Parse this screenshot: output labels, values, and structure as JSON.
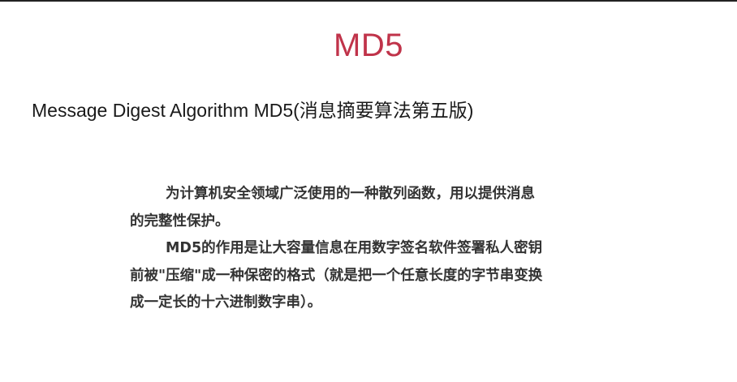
{
  "slide": {
    "title": "MD5",
    "subtitle": "Message Digest Algorithm MD5(消息摘要算法第五版)",
    "body_lines": [
      "为计算机安全领域广泛使用的一种散列函数，用以提供消息",
      "的完整性保护。",
      "MD5的作用是让大容量信息在用数字签名软件签署私人密钥",
      "前被\"压缩\"成一种保密的格式（就是把一个任意长度的字节串变换",
      "成一定长的十六进制数字串）。"
    ],
    "colors": {
      "title": "#c0334a",
      "subtitle": "#1a1a1a",
      "body": "#333333"
    }
  }
}
